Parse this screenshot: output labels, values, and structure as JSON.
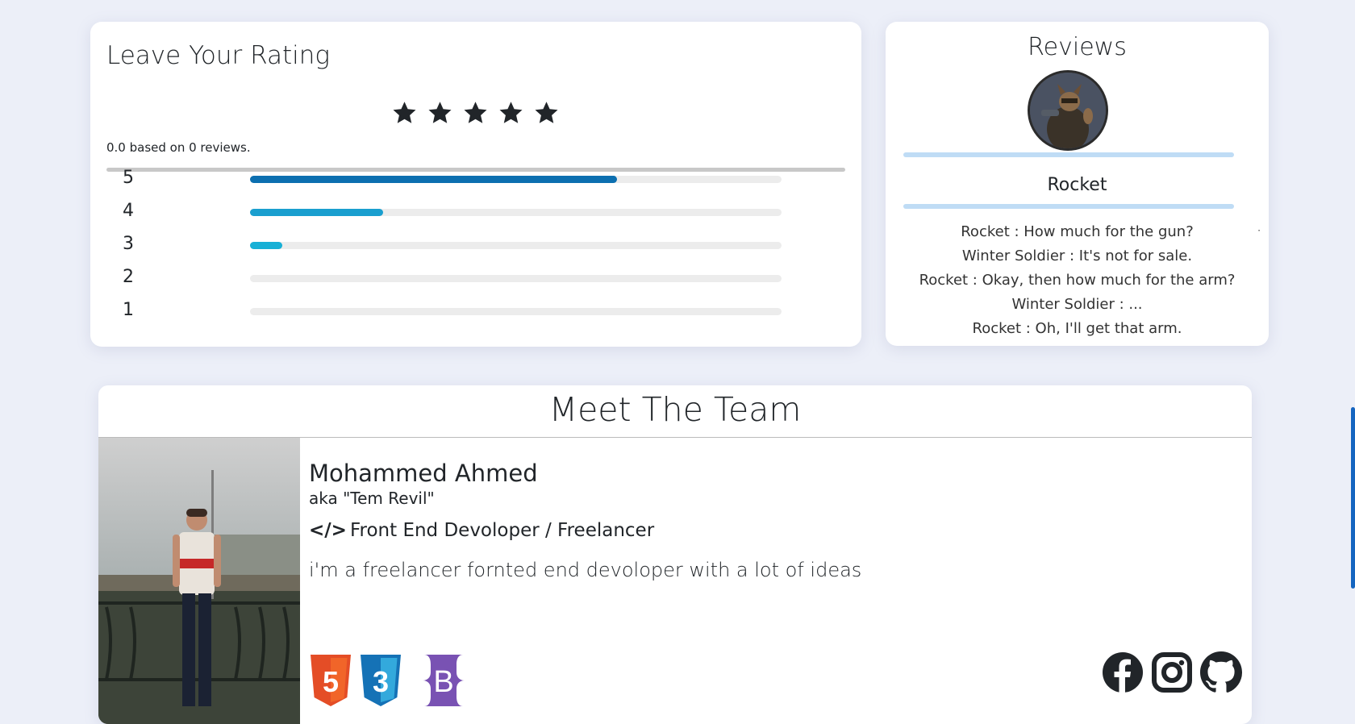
{
  "rating": {
    "title": "Leave Your Rating",
    "stars": 5,
    "summary": "0.0 based on 0 reviews.",
    "bars": [
      {
        "label": "5",
        "fraction": 0.69,
        "color": "#0c6fb0"
      },
      {
        "label": "4",
        "fraction": 0.25,
        "color": "#1a9fcf"
      },
      {
        "label": "3",
        "fraction": 0.06,
        "color": "#17b0d6"
      },
      {
        "label": "2",
        "fraction": 0,
        "color": "#17b0d6"
      },
      {
        "label": "1",
        "fraction": 0,
        "color": "#17b0d6"
      }
    ]
  },
  "reviews": {
    "title": "Reviews",
    "reviewer": "Rocket",
    "quote": [
      "Rocket : How much for the gun?",
      "Winter Soldier : It's not for sale.",
      "Rocket : Okay, then how much for the arm?",
      "Winter Soldier : ...",
      "Rocket : Oh, I'll get that arm."
    ]
  },
  "team": {
    "title": "Meet The Team",
    "member": {
      "name": "Mohammed Ahmed",
      "aka": "aka \"Tem Revil\"",
      "role": "Front End Devoloper / Freelancer",
      "bio": "i'm a freelancer fornted end devoloper with a lot of ideas",
      "tech": [
        {
          "icon": "html5-icon",
          "letter": "5",
          "color": "#e44d26"
        },
        {
          "icon": "css3-icon",
          "letter": "3",
          "color": "#1572b6"
        },
        {
          "icon": "bootstrap-icon",
          "letter": "B",
          "color": "#7952b3"
        }
      ],
      "social": [
        "facebook-icon",
        "instagram-icon",
        "github-icon"
      ]
    }
  },
  "colors": {
    "page_bg": "#eceff8",
    "star": "#212529",
    "scrollbar": "#1565c0"
  }
}
